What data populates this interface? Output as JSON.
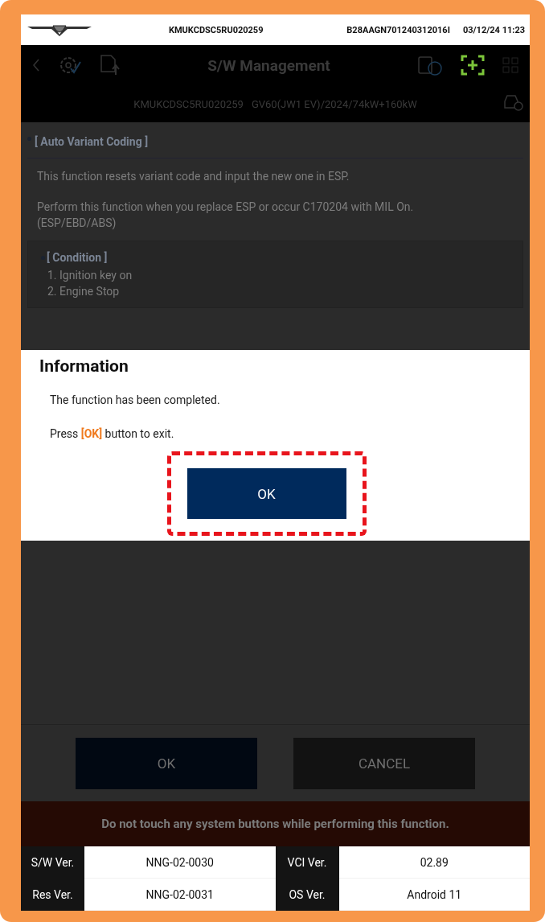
{
  "header": {
    "vin": "KMUKCDSC5RU020259",
    "device_id": "B28AAGN701240312016I",
    "datetime": "03/12/24 11:23"
  },
  "toolbar": {
    "title": "S/W Management",
    "scan_active": true
  },
  "vehicle": {
    "vin": "KMUKCDSC5RU020259",
    "model": "GV60(JW1 EV)/2024/74kW+160kW"
  },
  "section": {
    "title": "[ Auto Variant Coding ]",
    "paragraphs": [
      "This function resets variant code and input the new one in ESP.",
      "Perform this function when you replace ESP or occur C170204 with MIL On.\n(ESP/EBD/ABS)"
    ],
    "condition": {
      "title": "[ Condition ]",
      "items": [
        "1. Ignition key on",
        "2. Engine Stop"
      ]
    }
  },
  "dialog": {
    "title": "Information",
    "lines": [
      "The function has been completed.",
      "Press **[OK]** button to exit."
    ],
    "button": {
      "label": "OK",
      "highlighted": true
    }
  },
  "buttons": [
    {
      "label": "OK",
      "kind": "primary"
    },
    {
      "label": "CANCEL",
      "kind": "secondary"
    }
  ],
  "warning": "Do not touch any system buttons while performing this function.",
  "versions": [
    {
      "label": "S/W Ver.",
      "value": "NNG-02-0030"
    },
    {
      "label": "VCI Ver.",
      "value": "02.89"
    },
    {
      "label": "Res Ver.",
      "value": "NNG-02-0031"
    },
    {
      "label": "OS Ver.",
      "value": "Android 11"
    }
  ]
}
